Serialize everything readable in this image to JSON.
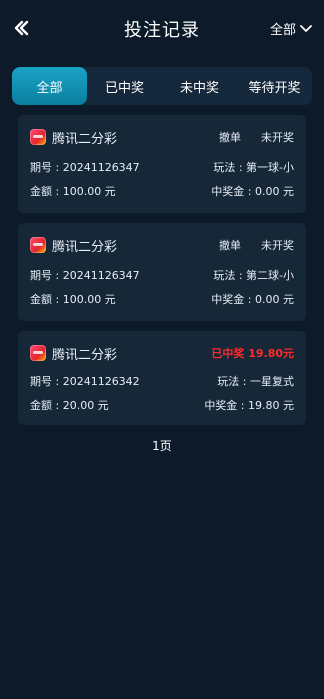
{
  "header": {
    "title": "投注记录",
    "filter_label": "全部"
  },
  "tabs": [
    {
      "label": "全部",
      "active": true
    },
    {
      "label": "已中奖",
      "active": false
    },
    {
      "label": "未中奖",
      "active": false
    },
    {
      "label": "等待开奖",
      "active": false
    }
  ],
  "records": [
    {
      "game": "腾讯二分彩",
      "action": "撤单",
      "status": "未开奖",
      "period": "期号 : 20241126347",
      "method": "玩法 : 第一球-小",
      "amount": "金额 : 100.00 元",
      "prize": "中奖金 : 0.00 元"
    },
    {
      "game": "腾讯二分彩",
      "action": "撤单",
      "status": "未开奖",
      "period": "期号 : 20241126347",
      "method": "玩法 : 第二球-小",
      "amount": "金额 : 100.00 元",
      "prize": "中奖金 : 0.00 元"
    },
    {
      "game": "腾讯二分彩",
      "action": "",
      "status": "已中奖 19.80元",
      "period": "期号 : 20241126342",
      "method": "玩法 : 一星复式",
      "amount": "金额 : 20.00 元",
      "prize": "中奖金 : 19.80 元"
    }
  ],
  "pager": {
    "label": "1页"
  },
  "colors": {
    "background": "#0d1a2a",
    "card": "#162737",
    "tab_bar": "#16283c",
    "tab_active": "#1aa3c6",
    "won_text": "#ff2b2b"
  },
  "icons": {
    "back": "chevron-left-double-icon",
    "filter": "chevron-down-icon",
    "game": "lottery-app-icon"
  }
}
